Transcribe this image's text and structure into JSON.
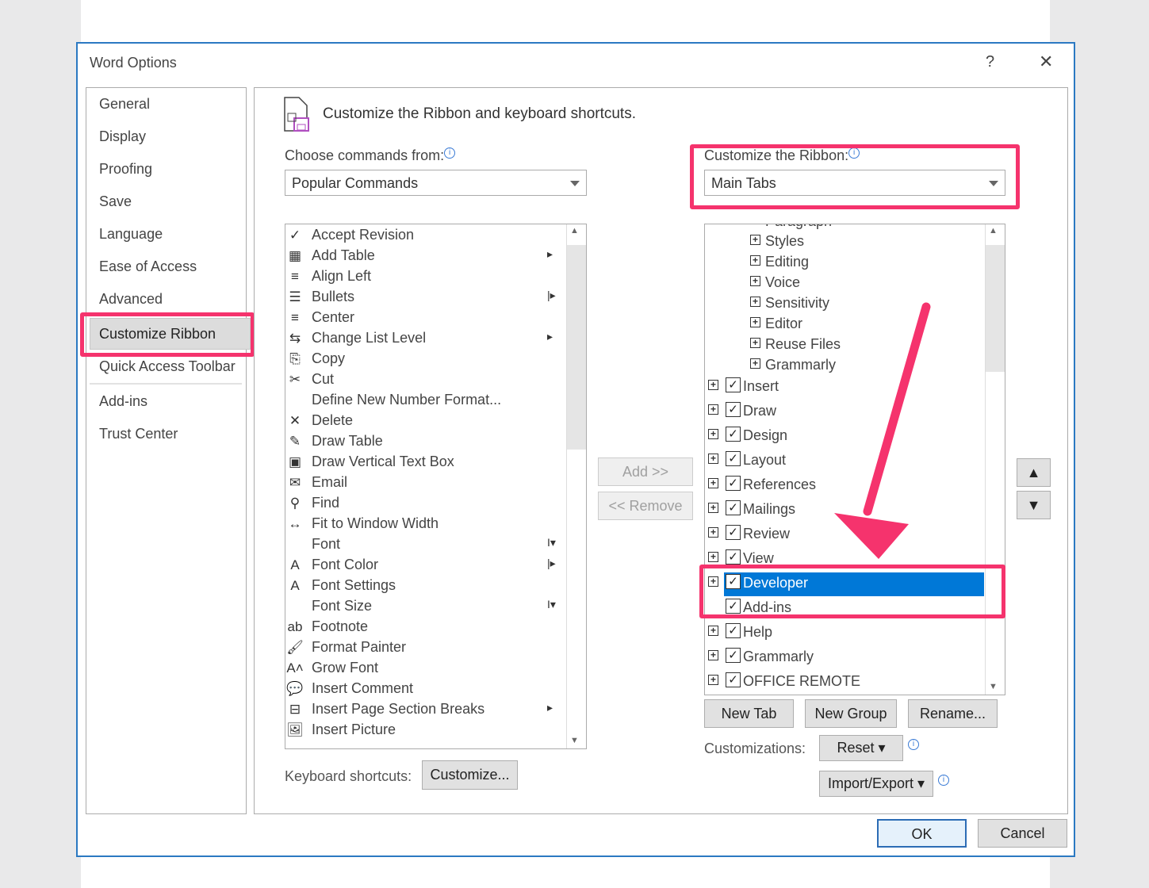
{
  "window": {
    "title": "Word Options",
    "help": "?",
    "close": "✕"
  },
  "nav": [
    "General",
    "Display",
    "Proofing",
    "Save",
    "Language",
    "Ease of Access",
    "Advanced",
    "Customize Ribbon",
    "Quick Access Toolbar",
    "Add-ins",
    "Trust Center"
  ],
  "header": "Customize the Ribbon and keyboard shortcuts.",
  "choose": {
    "label": "Choose commands from:",
    "value": "Popular Commands"
  },
  "ribbon": {
    "label": "Customize the Ribbon:",
    "value": "Main Tabs"
  },
  "commands": [
    {
      "label": "Accept Revision",
      "icon": "✓"
    },
    {
      "label": "Add Table",
      "icon": "▦",
      "sub": "▸"
    },
    {
      "label": "Align Left",
      "icon": "≡"
    },
    {
      "label": "Bullets",
      "icon": "☰",
      "sub": "|▸"
    },
    {
      "label": "Center",
      "icon": "≡"
    },
    {
      "label": "Change List Level",
      "icon": "⇆",
      "sub": "▸"
    },
    {
      "label": "Copy",
      "icon": "⎘"
    },
    {
      "label": "Cut",
      "icon": "✂"
    },
    {
      "label": "Define New Number Format...",
      "icon": ""
    },
    {
      "label": "Delete",
      "icon": "✕"
    },
    {
      "label": "Draw Table",
      "icon": "✎"
    },
    {
      "label": "Draw Vertical Text Box",
      "icon": "▣"
    },
    {
      "label": "Email",
      "icon": "✉"
    },
    {
      "label": "Find",
      "icon": "⚲"
    },
    {
      "label": "Fit to Window Width",
      "icon": "↔"
    },
    {
      "label": "Font",
      "icon": "",
      "sub": "I▾"
    },
    {
      "label": "Font Color",
      "icon": "A",
      "sub": "|▸"
    },
    {
      "label": "Font Settings",
      "icon": "A"
    },
    {
      "label": "Font Size",
      "icon": "",
      "sub": "I▾"
    },
    {
      "label": "Footnote",
      "icon": "ab"
    },
    {
      "label": "Format Painter",
      "icon": "🖌"
    },
    {
      "label": "Grow Font",
      "icon": "A˄"
    },
    {
      "label": "Insert Comment",
      "icon": "💬"
    },
    {
      "label": "Insert Page  Section Breaks",
      "icon": "⊟",
      "sub": "▸"
    },
    {
      "label": "Insert Picture",
      "icon": "🖼"
    }
  ],
  "tabs_partial": "Paragraph",
  "groups": [
    "Styles",
    "Editing",
    "Voice",
    "Sensitivity",
    "Editor",
    "Reuse Files",
    "Grammarly"
  ],
  "tabs": [
    {
      "label": "Insert",
      "checked": true,
      "expand": true
    },
    {
      "label": "Draw",
      "checked": true,
      "expand": true
    },
    {
      "label": "Design",
      "checked": true,
      "expand": true
    },
    {
      "label": "Layout",
      "checked": true,
      "expand": true
    },
    {
      "label": "References",
      "checked": true,
      "expand": true
    },
    {
      "label": "Mailings",
      "checked": true,
      "expand": true
    },
    {
      "label": "Review",
      "checked": true,
      "expand": true
    },
    {
      "label": "View",
      "checked": true,
      "expand": true
    },
    {
      "label": "Developer",
      "checked": true,
      "expand": true,
      "selected": true
    },
    {
      "label": "Add-ins",
      "checked": true,
      "expand": false
    },
    {
      "label": "Help",
      "checked": true,
      "expand": true
    },
    {
      "label": "Grammarly",
      "checked": true,
      "expand": true
    },
    {
      "label": "OFFICE REMOTE",
      "checked": true,
      "expand": true
    }
  ],
  "buttons": {
    "add": "Add >>",
    "remove": "<< Remove",
    "new_tab": "New Tab",
    "new_group": "New Group",
    "rename": "Rename...",
    "customizations": "Customizations:",
    "reset": "Reset ▾",
    "import_export": "Import/Export ▾",
    "kb_label": "Keyboard shortcuts:",
    "customize": "Customize...",
    "ok": "OK",
    "cancel": "Cancel"
  },
  "colors": {
    "highlight": "#f5336d",
    "selection": "#0078d7"
  }
}
